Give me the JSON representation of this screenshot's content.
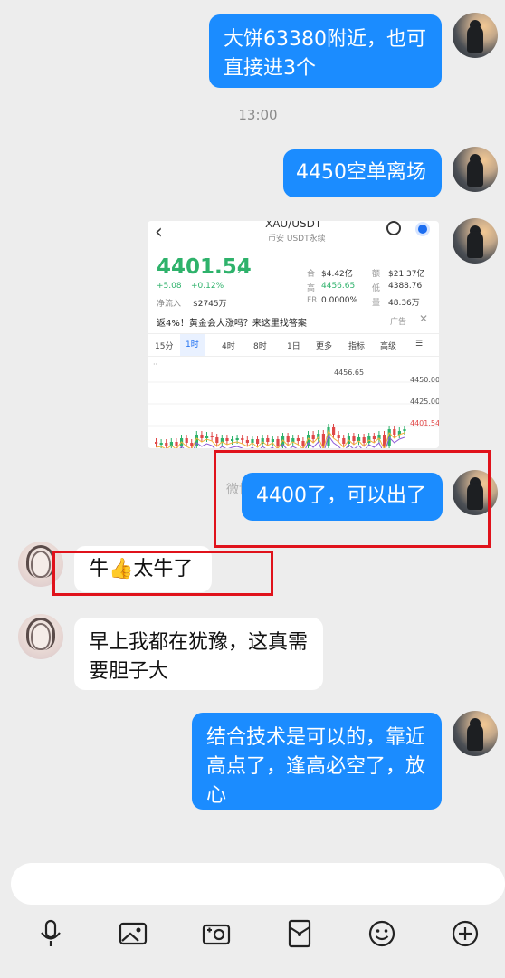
{
  "messages": {
    "m1": {
      "line1": "大饼63380附近，也可",
      "line2": "直接进3个"
    },
    "time": "13:00",
    "m2": "4450空单离场",
    "m3": "4400了，可以出了",
    "m4": "牛👍太牛了",
    "m5": {
      "line1": "早上我都在犹豫，这真需",
      "line2": "要胆子大"
    },
    "m6": {
      "line1": "结合技术是可以的，靠近",
      "line2": "高点了，逢高必空了，放",
      "line3": "心"
    }
  },
  "watermark": "微博@江一腾",
  "screenshot": {
    "back": "‹",
    "pair": "XAU/USDT",
    "subtitle": "币安 USDT永续",
    "price": "4401.54",
    "price_arrow": "↗",
    "change": "+5.08",
    "change_pct": "+0.12%",
    "inflow_label": "净流入",
    "inflow_value": "$2745万",
    "stats": {
      "oi_label": "合",
      "oi_value": "$4.42亿",
      "vol_label": "额",
      "vol_value": "$21.37亿",
      "high_label": "高",
      "high_value": "4456.65",
      "low_label": "低",
      "low_value": "4388.76",
      "fr_label": "FR",
      "fr_value": "0.0000%",
      "qty_label": "量",
      "qty_value": "48.36万"
    },
    "ad_text": "返4%！黄金会大涨吗？来这里找答案",
    "ad_tag": "广告",
    "ad_close": "✕",
    "tabs": [
      "15分",
      "1时",
      "4时",
      "8时",
      "1日",
      "更多",
      "指标",
      "高级"
    ],
    "chart_labels": {
      "high_marker": "4456.65",
      "level1": "4450.00",
      "level2": "4425.00",
      "current": "4401.54"
    },
    "colors": {
      "up": "#2eb26b",
      "down": "#e04848"
    }
  },
  "toolbar": {
    "icons": [
      "microphone-icon",
      "image-icon",
      "camera-icon",
      "red-packet-icon",
      "emoji-icon",
      "plus-icon"
    ]
  },
  "colors": {
    "bubble_blue": "#1b8cff",
    "highlight_red": "#e0121b",
    "background": "#ededed"
  }
}
